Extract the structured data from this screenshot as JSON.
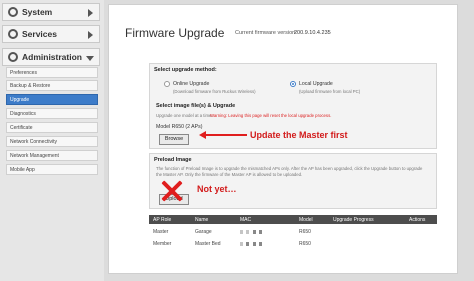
{
  "sidebar": {
    "system": "System",
    "services": "Services",
    "administration": "Administration",
    "items": [
      {
        "label": "Preferences"
      },
      {
        "label": "Backup & Restore"
      },
      {
        "label": "Upgrade"
      },
      {
        "label": "Diagnostics"
      },
      {
        "label": "Certificate"
      },
      {
        "label": "Network Connectivity"
      },
      {
        "label": "Network Management"
      },
      {
        "label": "Mobile App"
      }
    ]
  },
  "main": {
    "title": "Firmware Upgrade",
    "fw_label": "Current firmware version:",
    "fw_version": "200.9.10.4.235",
    "method_title": "Select upgrade method:",
    "online": {
      "label": "Online Upgrade",
      "desc": "(Download firmware from Ruckus Wireless)"
    },
    "local": {
      "label": "Local Upgrade",
      "desc": "(Upload firmware from local PC)"
    },
    "select_title": "Select image file(s) & Upgrade",
    "upgrade_note": "Upgrade one model at a time.",
    "warning": "Warning: Leaving this page will reset the local upgrade process.",
    "model": "Model R650 (2 APs)",
    "browse": "Browse",
    "preload_title": "Preload Image",
    "preload_desc1": "The function of Preload Image is to upgrade the mismatched APs only. After the AP has been upgraded, click the Upgrade button to upgrade",
    "preload_desc2": "the Master AP. Only the firmware of the Master AP is allowed to be uploaded.",
    "preload_button": "Upload"
  },
  "annotations": {
    "arrow_text": "Update the Master first",
    "x_text": "Not yet…"
  },
  "table": {
    "headers": [
      "AP Role",
      "Name",
      "MAC",
      "Model",
      "Upgrade Progress",
      "Actions"
    ],
    "rows": [
      {
        "role": "Master",
        "name": "Garage",
        "model": "R650"
      },
      {
        "role": "Member",
        "name": "Master Bed",
        "model": "R650"
      }
    ]
  },
  "colors": {
    "accent": "#3d7cc9",
    "annotation": "#e01e1e"
  }
}
